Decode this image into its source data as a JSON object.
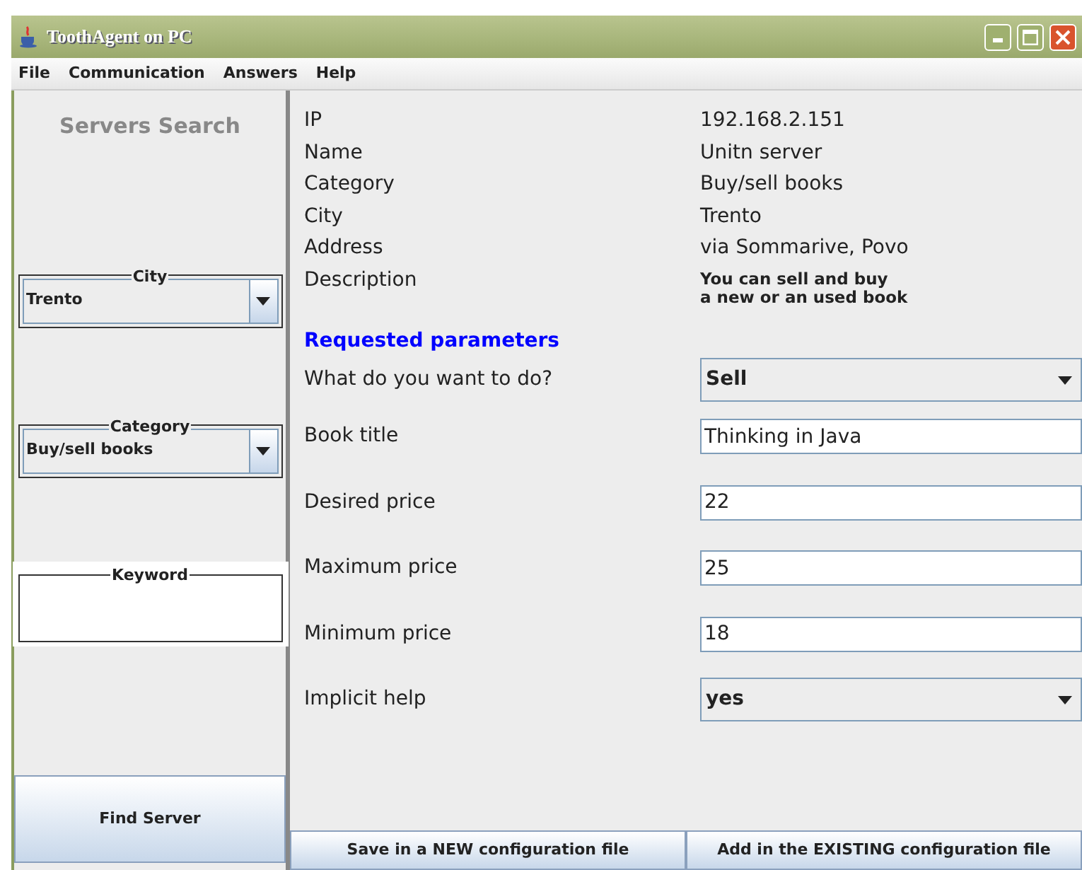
{
  "window": {
    "title": "ToothAgent on PC"
  },
  "menu": [
    "File",
    "Communication",
    "Answers",
    "Help"
  ],
  "sidebar": {
    "title": "Servers Search",
    "city": {
      "label": "City",
      "value": "Trento"
    },
    "category": {
      "label": "Category",
      "value": "Buy/sell books"
    },
    "keyword": {
      "label": "Keyword"
    },
    "button": "Find Server"
  },
  "server_info": [
    {
      "label": "IP",
      "value": "192.168.2.151"
    },
    {
      "label": "Name",
      "value": "Unitn server"
    },
    {
      "label": "Category",
      "value": "Buy/sell books"
    },
    {
      "label": "City",
      "value": "Trento"
    },
    {
      "label": "Address",
      "value": "via Sommarive, Povo"
    },
    {
      "label": "Description",
      "value": "You can sell and buy\na new or an used book",
      "kind": "note"
    }
  ],
  "parameters_heading": "Requested parameters",
  "parameters": [
    {
      "label": "What do you want to do?",
      "kind": "select",
      "value": "Sell"
    },
    {
      "label": "Book title",
      "kind": "text",
      "value": "Thinking in Java"
    },
    {
      "label": "Desired price",
      "kind": "text",
      "value": "22"
    },
    {
      "label": "Maximum price",
      "kind": "text",
      "value": "25"
    },
    {
      "label": "Minimum price",
      "kind": "text",
      "value": "18"
    },
    {
      "label": "Implicit help",
      "kind": "select",
      "value": "yes"
    }
  ],
  "buttons": [
    "Save in a NEW configuration file",
    "Add in the EXISTING configuration file"
  ]
}
